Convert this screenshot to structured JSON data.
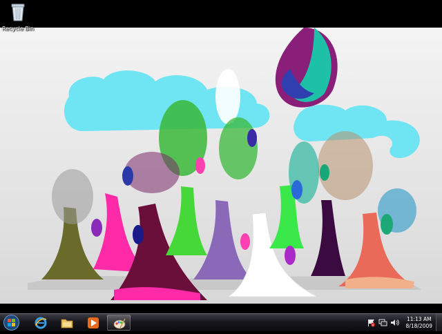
{
  "desktop": {
    "icons": [
      {
        "label": "Recycle Bin",
        "icon": "recycle-bin-icon"
      }
    ],
    "wallpaper": "psychedelic-trees-wallpaper"
  },
  "taskbar": {
    "start_icon": "windows-start-orb-icon",
    "pinned": [
      {
        "icon": "internet-explorer-icon"
      },
      {
        "icon": "windows-explorer-folder-icon"
      },
      {
        "icon": "media-player-icon"
      },
      {
        "icon": "paint-icon"
      }
    ],
    "tray": {
      "icons": [
        "action-center-flag-icon",
        "network-icon",
        "volume-icon"
      ],
      "time": "11:13 AM",
      "date": "8/18/2009"
    }
  },
  "colors": {
    "taskbar": "#18181e",
    "wallpaper_bg": "#e6e6e6",
    "cloud": "#6fe4f2"
  }
}
